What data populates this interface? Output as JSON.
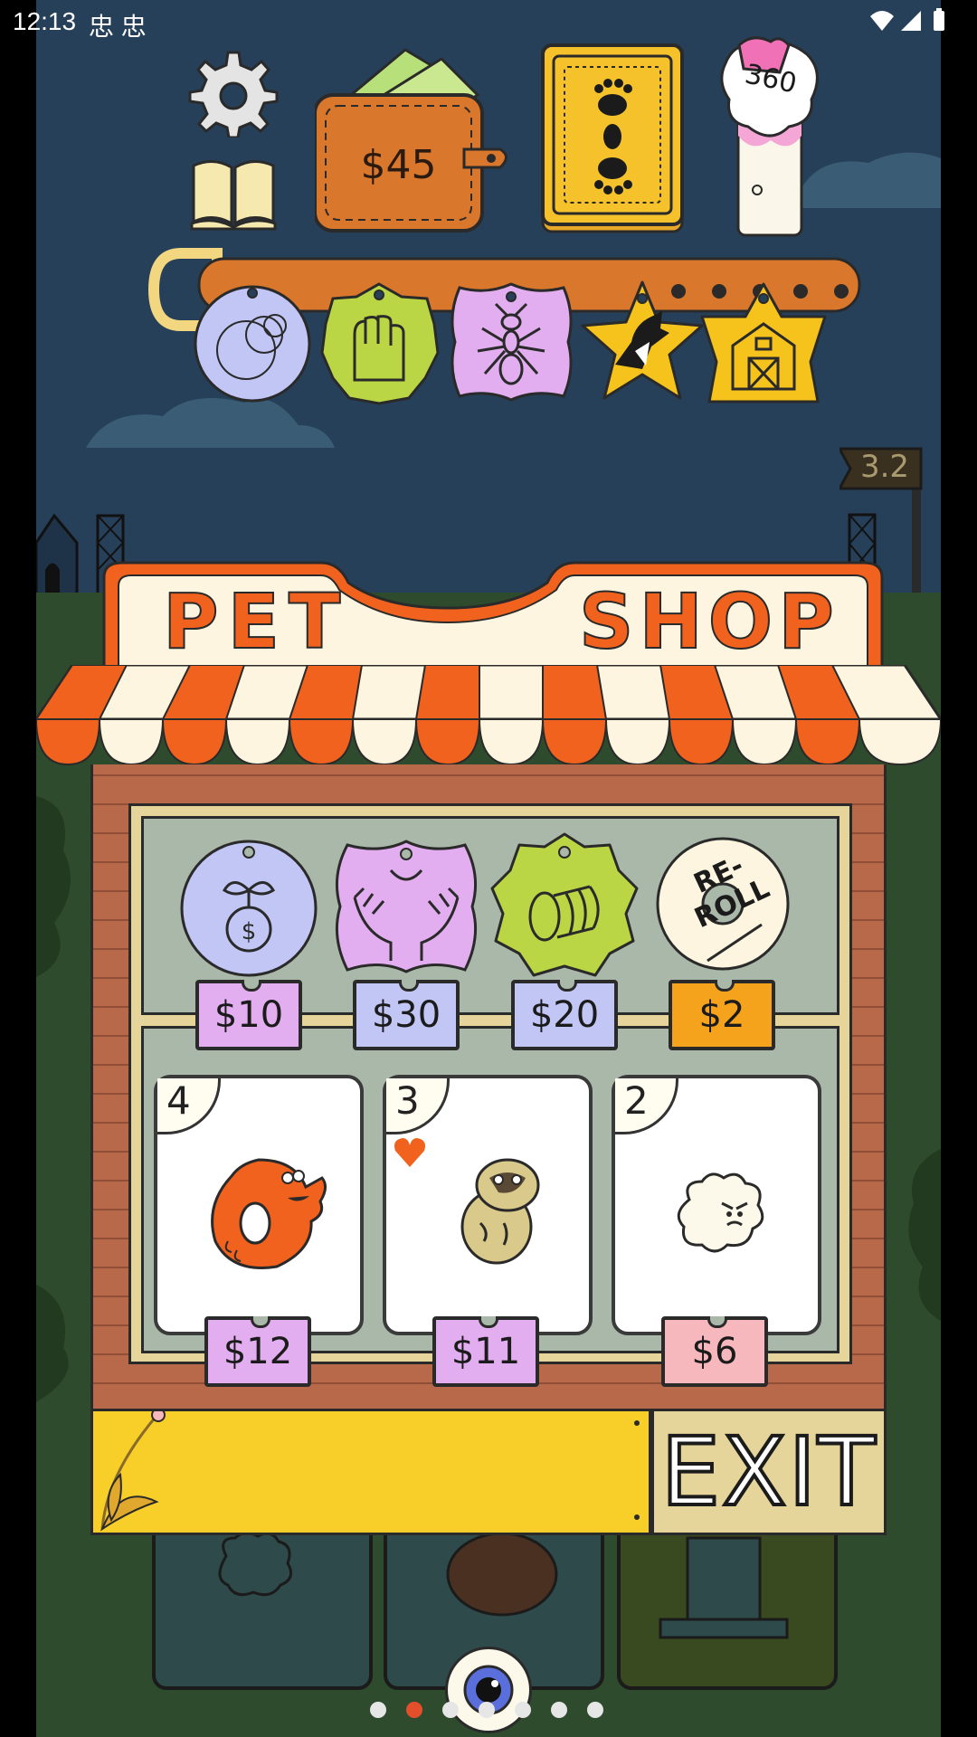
{
  "status_bar": {
    "time": "12:13",
    "notif_icons": "忠 忠"
  },
  "hud": {
    "money": "$45",
    "score": "360",
    "level": "3.2"
  },
  "shop": {
    "sign_left": "PET",
    "sign_right": "SHOP",
    "items": [
      {
        "icon": "money-plant-icon",
        "price": "$10"
      },
      {
        "icon": "caring-hands-icon",
        "price": "$30"
      },
      {
        "icon": "coin-stack-icon",
        "price": "$20"
      },
      {
        "label": "RE-ROLL",
        "price": "$2"
      }
    ],
    "pets": [
      {
        "name": "orange-dog",
        "level": "4",
        "price": "$12"
      },
      {
        "name": "pug",
        "level": "3",
        "price": "$11"
      },
      {
        "name": "white-fluff",
        "level": "2",
        "price": "$6"
      }
    ],
    "exit_label": "EXIT"
  },
  "colors": {
    "sky": "#27405a",
    "awning_orange": "#f0621e",
    "brick": "#b8694a",
    "tag_lavender": "#c1c6f4",
    "tag_pink": "#e3aef0",
    "tag_lime": "#bad645",
    "tag_yellow": "#f5c31c"
  }
}
